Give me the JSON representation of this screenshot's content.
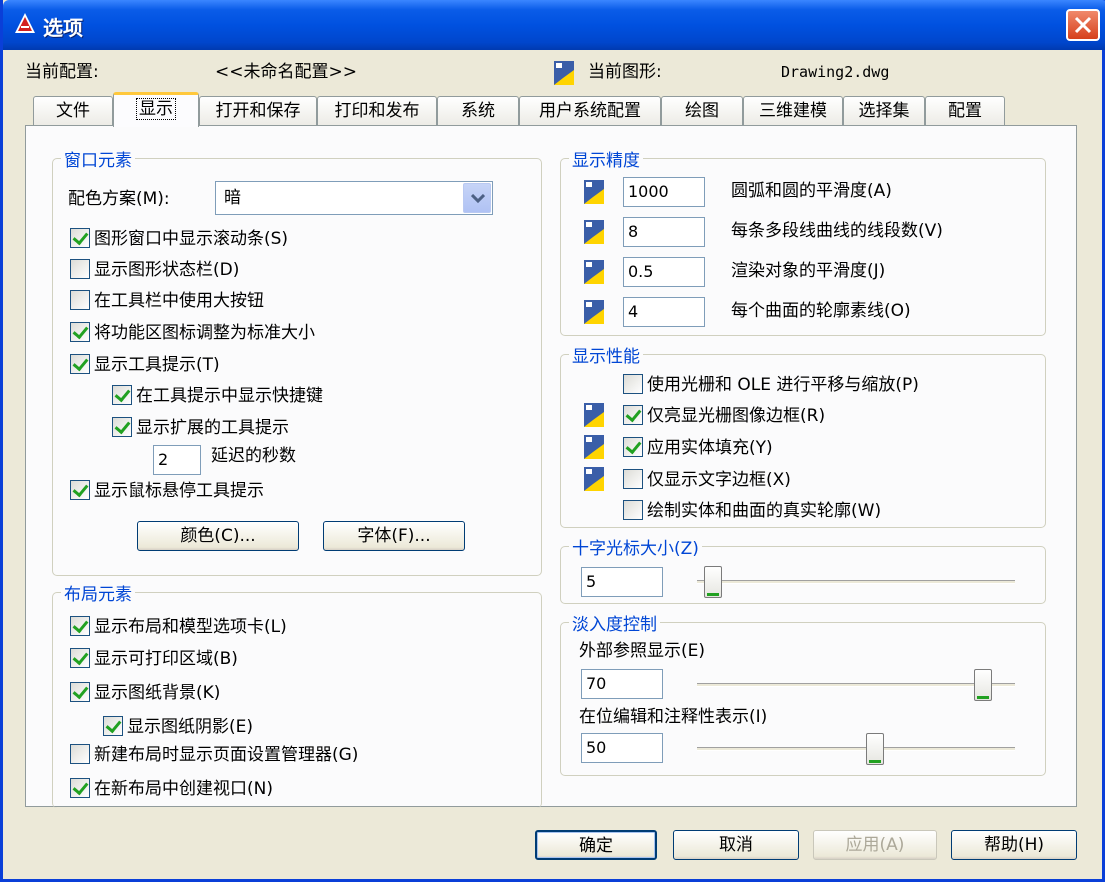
{
  "window": {
    "title": "选项",
    "close": "×"
  },
  "header": {
    "current_profile_label": "当前配置:",
    "current_profile_value": "<<未命名配置>>",
    "current_drawing_label": "当前图形:",
    "current_drawing_value": "Drawing2.dwg"
  },
  "tabs": [
    {
      "label": "文件"
    },
    {
      "label": "显示"
    },
    {
      "label": "打开和保存"
    },
    {
      "label": "打印和发布"
    },
    {
      "label": "系统"
    },
    {
      "label": "用户系统配置"
    },
    {
      "label": "绘图"
    },
    {
      "label": "三维建模"
    },
    {
      "label": "选择集"
    },
    {
      "label": "配置"
    }
  ],
  "active_tab": "显示",
  "window_elements": {
    "title": "窗口元素",
    "color_scheme_label": "配色方案(M):",
    "color_scheme_value": "暗",
    "options": [
      {
        "label": "图形窗口中显示滚动条(S)",
        "checked": true
      },
      {
        "label": "显示图形状态栏(D)",
        "checked": false
      },
      {
        "label": "在工具栏中使用大按钮",
        "checked": false
      },
      {
        "label": "将功能区图标调整为标准大小",
        "checked": true
      },
      {
        "label": "显示工具提示(T)",
        "checked": true
      },
      {
        "label": "在工具提示中显示快捷键",
        "checked": true
      },
      {
        "label": "显示扩展的工具提示",
        "checked": true
      },
      {
        "label": "显示鼠标悬停工具提示",
        "checked": true
      }
    ],
    "delay_value": "2",
    "delay_label": "延迟的秒数",
    "colors_button": "颜色(C)...",
    "fonts_button": "字体(F)..."
  },
  "layout_elements": {
    "title": "布局元素",
    "options": [
      {
        "label": "显示布局和模型选项卡(L)",
        "checked": true
      },
      {
        "label": "显示可打印区域(B)",
        "checked": true
      },
      {
        "label": "显示图纸背景(K)",
        "checked": true
      },
      {
        "label": "显示图纸阴影(E)",
        "checked": true
      },
      {
        "label": "新建布局时显示页面设置管理器(G)",
        "checked": false
      },
      {
        "label": "在新布局中创建视口(N)",
        "checked": true
      }
    ]
  },
  "display_resolution": {
    "title": "显示精度",
    "items": [
      {
        "value": "1000",
        "label": "圆弧和圆的平滑度(A)"
      },
      {
        "value": "8",
        "label": "每条多段线曲线的线段数(V)"
      },
      {
        "value": "0.5",
        "label": "渲染对象的平滑度(J)"
      },
      {
        "value": "4",
        "label": "每个曲面的轮廓素线(O)"
      }
    ]
  },
  "display_performance": {
    "title": "显示性能",
    "options": [
      {
        "label": "使用光栅和 OLE 进行平移与缩放(P)",
        "checked": false
      },
      {
        "label": "仅亮显光栅图像边框(R)",
        "checked": true
      },
      {
        "label": "应用实体填充(Y)",
        "checked": true
      },
      {
        "label": "仅显示文字边框(X)",
        "checked": false
      },
      {
        "label": "绘制实体和曲面的真实轮廓(W)",
        "checked": false
      }
    ]
  },
  "crosshair": {
    "title": "十字光标大小(Z)",
    "value": "5",
    "slider_fraction": 0.05
  },
  "fade": {
    "title": "淡入度控制",
    "xref_label": "外部参照显示(E)",
    "xref_value": "70",
    "xref_fraction": 0.9,
    "inplace_label": "在位编辑和注释性表示(I)",
    "inplace_value": "50",
    "inplace_fraction": 0.56
  },
  "footer": {
    "ok": "确定",
    "cancel": "取消",
    "apply": "应用(A)",
    "help": "帮助(H)"
  },
  "colors": {
    "title_bar": "#0051e0",
    "group_title": "#0046d5",
    "checkmark": "#21a121"
  }
}
